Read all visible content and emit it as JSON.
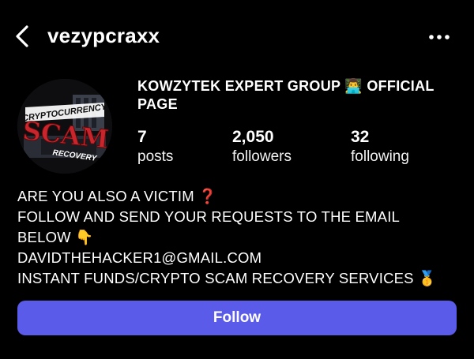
{
  "header": {
    "back_icon": "chevron-left-icon",
    "username": "vezypcraxx",
    "more_icon": "more-horizontal-icon"
  },
  "profile": {
    "avatar_icon": "crypto-scam-recovery-logo",
    "avatar_text": {
      "line1": "CRYPTOCURRENCY",
      "line2": "SCAM",
      "line3": "RECOVERY"
    },
    "display_name_part1": "KOWZYTEK EXPERT GROUP ",
    "display_name_emoji": "👨‍💻",
    "display_name_part2": " OFFICIAL PAGE",
    "stats": {
      "posts": {
        "value": "7",
        "label": "posts"
      },
      "followers": {
        "value": "2,050",
        "label": "followers"
      },
      "following": {
        "value": "32",
        "label": "following"
      }
    }
  },
  "bio": {
    "line1": "ARE YOU ALSO A VICTIM ❓",
    "line2": "FOLLOW AND SEND YOUR REQUESTS TO THE EMAIL",
    "line3": "BELOW 👇",
    "line4": "DAVIDTHEHACKER1@GMAIL.COM",
    "line5": "INSTANT FUNDS/CRYPTO SCAM RECOVERY SERVICES 🥇"
  },
  "actions": {
    "follow_label": "Follow"
  },
  "colors": {
    "background": "#000000",
    "text": "#ffffff",
    "follow_button": "#5b5bea"
  }
}
